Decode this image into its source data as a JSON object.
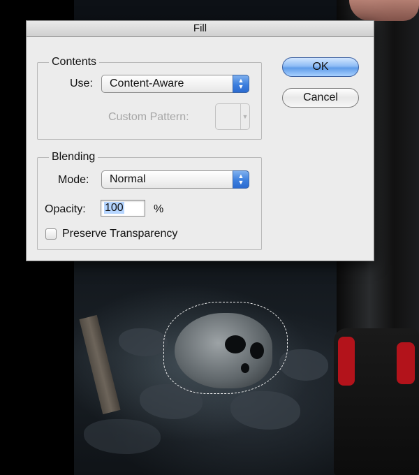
{
  "dialog": {
    "title": "Fill",
    "contents": {
      "legend": "Contents",
      "use_label": "Use:",
      "use_value": "Content-Aware",
      "custom_pattern_label": "Custom Pattern:"
    },
    "blending": {
      "legend": "Blending",
      "mode_label": "Mode:",
      "mode_value": "Normal",
      "opacity_label": "Opacity:",
      "opacity_value": "100",
      "opacity_unit": "%",
      "preserve_transparency_label": "Preserve Transparency",
      "preserve_transparency_checked": false
    },
    "buttons": {
      "ok": "OK",
      "cancel": "Cancel"
    }
  },
  "colors": {
    "dialog_bg": "#ececec",
    "accent_blue": "#3c7fde",
    "boot_red": "#b3131b"
  },
  "icons": {
    "popup_arrows": "up-down-chevron-icon",
    "disabled_popup_arrow": "chevron-down-icon"
  }
}
